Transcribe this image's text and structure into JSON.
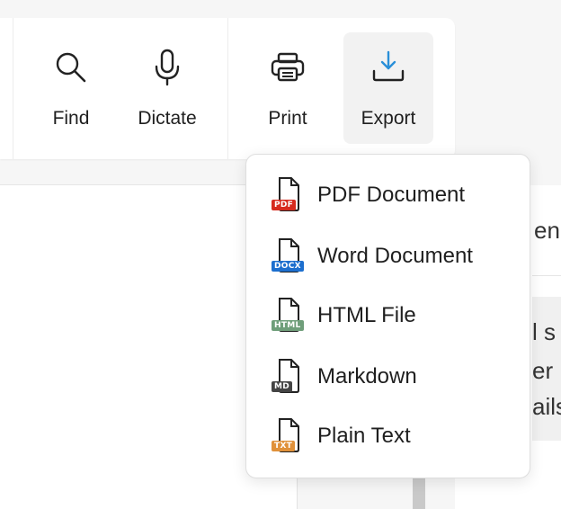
{
  "toolbar": {
    "find": {
      "label": "Find",
      "icon": "search-icon"
    },
    "dictate": {
      "label": "Dictate",
      "icon": "microphone-icon"
    },
    "print": {
      "label": "Print",
      "icon": "printer-icon"
    },
    "export": {
      "label": "Export",
      "icon": "download-icon",
      "active": true
    }
  },
  "export_menu": {
    "items": [
      {
        "label": "PDF Document",
        "badge": "PDF",
        "badge_color": "#d62b1f"
      },
      {
        "label": "Word Document",
        "badge": "DOCX",
        "badge_color": "#1d6fce"
      },
      {
        "label": "HTML File",
        "badge": "HTML",
        "badge_color": "#6f9e7a"
      },
      {
        "label": "Markdown",
        "badge": "MD",
        "badge_color": "#444444"
      },
      {
        "label": "Plain Text",
        "badge": "TXT",
        "badge_color": "#e0913a"
      }
    ]
  },
  "background_text": {
    "line1": "en",
    "line2": "l s",
    "line3": "er",
    "line4": "ails"
  },
  "colors": {
    "accent": "#2a8fd8"
  }
}
